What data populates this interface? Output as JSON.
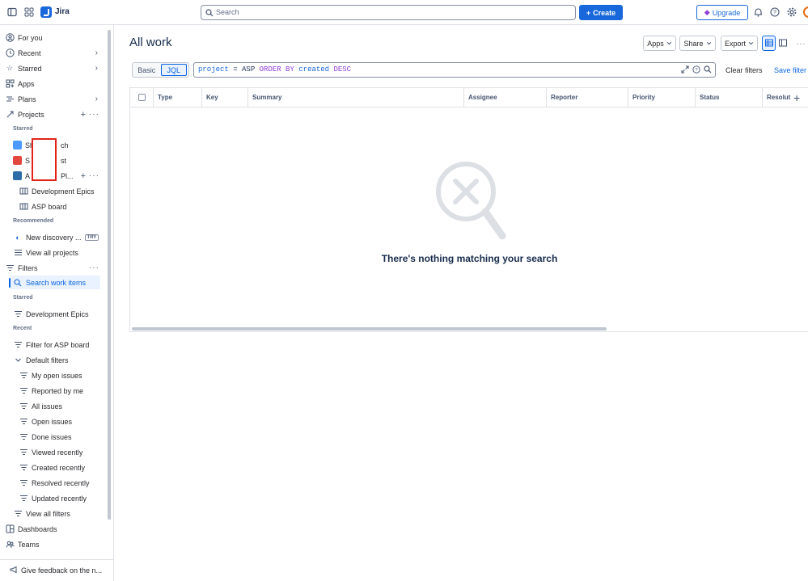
{
  "topbar": {
    "brand": "Jira",
    "search_placeholder": "Search",
    "create_label": "Create",
    "upgrade_label": "Upgrade",
    "icons": [
      "sidebar-toggle-icon",
      "app-switcher-icon",
      "bell-icon",
      "help-icon",
      "settings-icon"
    ]
  },
  "sidebar": {
    "for_you": "For you",
    "recent": "Recent",
    "starred": "Starred",
    "apps": "Apps",
    "plans": "Plans",
    "projects": "Projects",
    "starred_head": "Starred",
    "project1": "Sh",
    "project1_suffix": "ch",
    "project2": "S",
    "project2_suffix": "st",
    "project3": "A",
    "project3_suffix": "Pl...",
    "dev_epics": "Development Epics",
    "asp_board": "ASP board",
    "recommended_head": "Recommended",
    "new_discovery": "New discovery ...",
    "try_badge": "TRY",
    "view_all_projects": "View all projects",
    "filters": "Filters",
    "search_work_items": "Search work items",
    "starred_head2": "Starred",
    "filter_dev_epics": "Development Epics",
    "recent_head": "Recent",
    "filter_asp": "Filter for ASP board",
    "default_filters": "Default filters",
    "default_items": [
      "My open issues",
      "Reported by me",
      "All issues",
      "Open issues",
      "Done issues",
      "Viewed recently",
      "Created recently",
      "Resolved recently",
      "Updated recently"
    ],
    "view_all_filters": "View all filters",
    "dashboards": "Dashboards",
    "teams": "Teams",
    "feedback": "Give feedback on the n..."
  },
  "main": {
    "title": "All work",
    "apps_btn": "Apps",
    "share_btn": "Share",
    "export_btn": "Export",
    "mode_basic": "Basic",
    "mode_jql": "JQL",
    "jql": {
      "field": "project",
      "op": "=",
      "value": "ASP",
      "order": "ORDER BY",
      "sort_field": "created",
      "dir": "DESC"
    },
    "clear_filters": "Clear filters",
    "save_filter": "Save filter",
    "columns": [
      "Type",
      "Key",
      "Summary",
      "Assignee",
      "Reporter",
      "Priority",
      "Status",
      "Resolut"
    ],
    "empty_message": "There's nothing matching your search"
  }
}
